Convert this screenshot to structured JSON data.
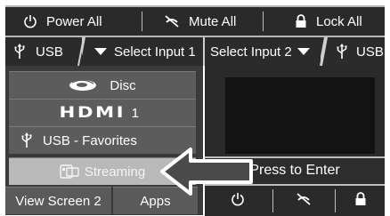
{
  "topbar": {
    "power_all": "Power All",
    "mute_all": "Mute All",
    "lock_all": "Lock All"
  },
  "tabs": {
    "usb_left": "USB",
    "select_input_1": "Select Input 1",
    "select_input_2": "Select Input 2",
    "usb_right": "USB"
  },
  "sources": [
    {
      "label": "Disc",
      "icon": "bluray-disc-icon"
    },
    {
      "label": "1",
      "icon": "hdmi-logo-icon",
      "logo_text": "HDMI"
    },
    {
      "label": "USB - Favorites",
      "icon": "usb-icon"
    },
    {
      "label": "Streaming",
      "icon": "streaming-icon",
      "selected": true
    }
  ],
  "bottom": {
    "view_screen_2": "View Screen 2",
    "apps": "Apps"
  },
  "screen2": {
    "press_to_enter": "Press to Enter"
  },
  "colors": {
    "bar_bg": "#2a2a2a",
    "button_bg": "#5c5c5c",
    "selected_bg": "#b9b9b9",
    "separator": "#bdbdbd"
  }
}
